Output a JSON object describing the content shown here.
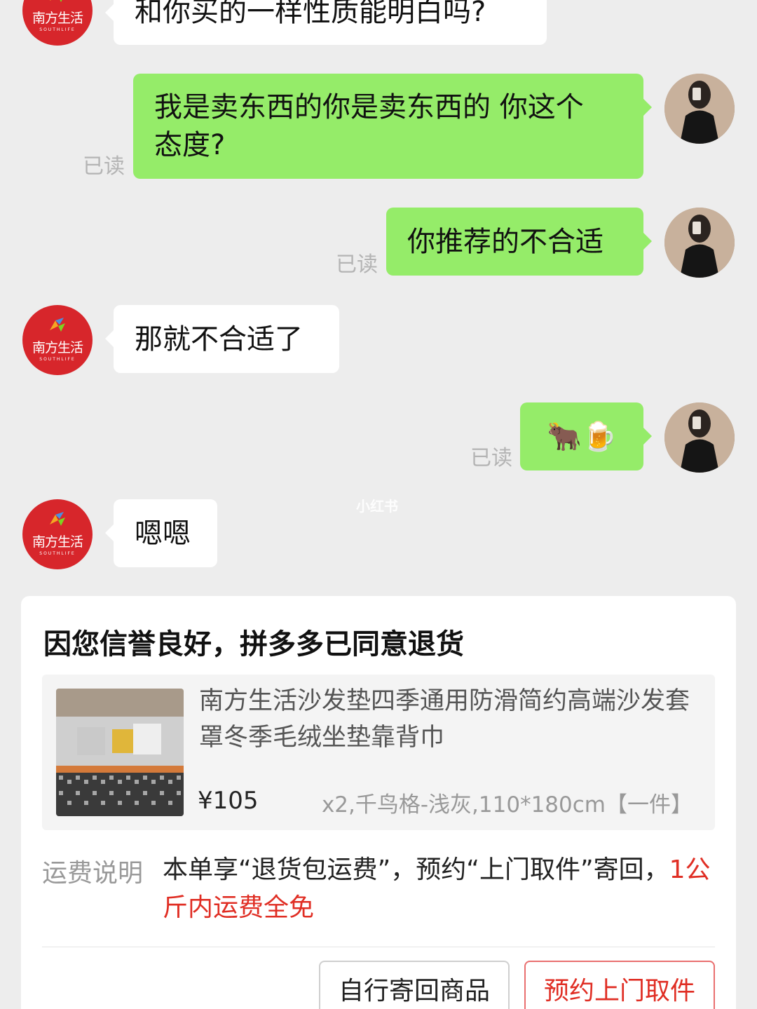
{
  "chat": {
    "messages": [
      {
        "id": "m0",
        "side": "left",
        "text": "和你买的一样性质能明白吗?"
      },
      {
        "id": "m1",
        "side": "right",
        "text_line1": "我是卖东西的你是卖东西的 你这个",
        "text_line2": "态度?",
        "read": "已读"
      },
      {
        "id": "m2",
        "side": "right",
        "text": "你推荐的不合适",
        "read": "已读"
      },
      {
        "id": "m3",
        "side": "left",
        "text": "那就不合适了"
      },
      {
        "id": "m4",
        "side": "right",
        "text": "🐂🍺",
        "read": "已读"
      },
      {
        "id": "m5",
        "side": "left",
        "text": "嗯嗯"
      }
    ],
    "shop_avatar": {
      "name_cn": "南方生活",
      "name_en": "SOUTHLIFE"
    },
    "watermark": "小红书"
  },
  "refund_card": {
    "title": "因您信誉良好，拼多多已同意退货",
    "product": {
      "name": "南方生活沙发垫四季通用防滑简约高端沙发套罩冬季毛绒坐垫靠背巾",
      "price": "¥105",
      "spec": "x2,千鸟格-浅灰,110*180cm【一件】"
    },
    "shipping": {
      "label": "运费说明",
      "text": "本单享“退货包运费”，预约“上门取件”寄回，",
      "highlight": "1公斤内运费全免"
    },
    "buttons": {
      "self_return": "自行寄回商品",
      "pickup": "预约上门取件"
    }
  },
  "colors": {
    "background": "#ededed",
    "bubble_right": "#95ec69",
    "bubble_left": "#ffffff",
    "accent_red": "#e02e24",
    "shop_avatar_red": "#d7262b"
  }
}
